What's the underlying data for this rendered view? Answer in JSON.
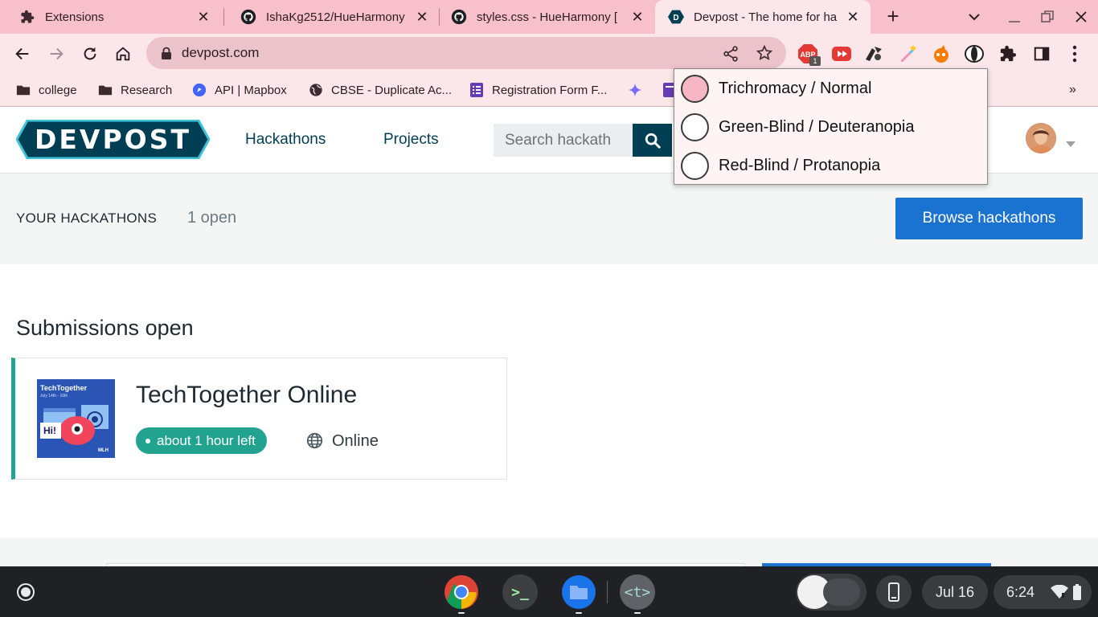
{
  "browser": {
    "tabs": [
      {
        "title": "Extensions",
        "icon": "puzzle-icon"
      },
      {
        "title": "IshaKg2512/HueHarmony",
        "icon": "github-icon"
      },
      {
        "title": "styles.css - HueHarmony [",
        "icon": "github-icon"
      },
      {
        "title": "Devpost - The home for ha",
        "icon": "devpost-icon"
      }
    ],
    "active_tab_index": 3,
    "new_tab_label": "+",
    "url": "devpost.com",
    "extension_badge_count": "1",
    "extension_badge_text": "ABP",
    "bookmarks": [
      {
        "label": "college",
        "icon": "folder-icon"
      },
      {
        "label": "Research",
        "icon": "folder-icon"
      },
      {
        "label": "API | Mapbox",
        "icon": "mapbox-icon"
      },
      {
        "label": "CBSE - Duplicate Ac...",
        "icon": "globe-icon"
      },
      {
        "label": "Registration Form F...",
        "icon": "forms-icon"
      }
    ],
    "bookmarks_overflow": "»"
  },
  "devpost": {
    "logo_text": "DEVPOST",
    "nav": {
      "hackathons": "Hackathons",
      "projects": "Projects"
    },
    "search_placeholder": "Search hackath",
    "your_hackathons_label": "YOUR HACKATHONS",
    "open_count": "1 open",
    "browse_button": "Browse hackathons",
    "section_title": "Submissions open",
    "hackathon": {
      "name": "TechTogether Online",
      "time_left": "about 1 hour left",
      "location": "Online",
      "thumb_title": "TechTogether",
      "thumb_date": "July 14th - 16th",
      "thumb_hi": "Hi!",
      "thumb_sponsor": "MLH"
    }
  },
  "popup": {
    "options": [
      {
        "label": "Trichromacy / Normal",
        "selected": true
      },
      {
        "label": "Green-Blind / Deuteranopia",
        "selected": false
      },
      {
        "label": "Red-Blind / Protanopia",
        "selected": false
      }
    ]
  },
  "shelf": {
    "date": "Jul 16",
    "time": "6:24",
    "terminal_label": ">_",
    "text_app_label": "<t>"
  },
  "colors": {
    "tabstrip": "#f7c0cb",
    "toolbar": "#fbe6ea",
    "devpost_navy": "#003e54",
    "devpost_teal": "#21a390",
    "browse_blue": "#1a73d0"
  }
}
